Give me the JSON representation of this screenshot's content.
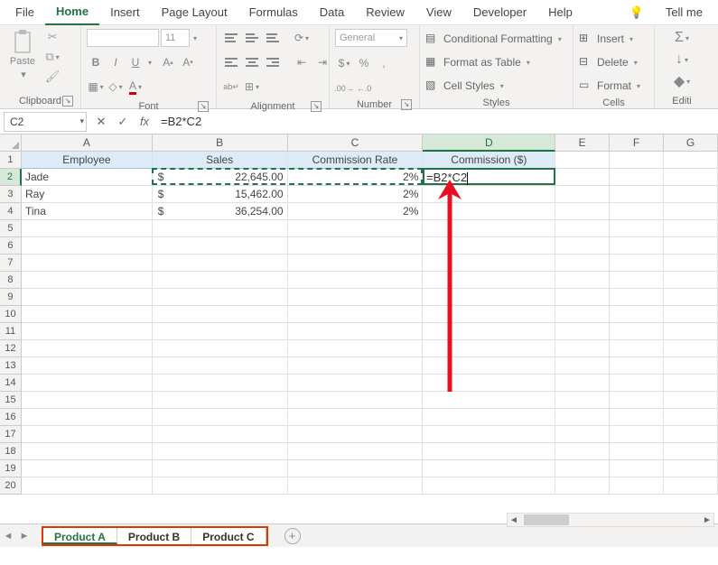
{
  "ribbon_tabs": {
    "file": "File",
    "home": "Home",
    "insert": "Insert",
    "page_layout": "Page Layout",
    "formulas": "Formulas",
    "data": "Data",
    "review": "Review",
    "view": "View",
    "developer": "Developer",
    "help": "Help",
    "tellme": "Tell me"
  },
  "clipboard": {
    "paste": "Paste",
    "label": "Clipboard"
  },
  "font": {
    "name": "",
    "size": "11",
    "bold": "B",
    "italic": "I",
    "underline": "U",
    "label": "Font"
  },
  "alignment": {
    "label": "Alignment"
  },
  "number": {
    "format": "General",
    "label": "Number"
  },
  "styles": {
    "cond": "Conditional Formatting",
    "table": "Format as Table",
    "cell": "Cell Styles",
    "label": "Styles"
  },
  "cells": {
    "insert": "Insert",
    "delete": "Delete",
    "format": "Format",
    "label": "Cells"
  },
  "editing": {
    "label": "Editi"
  },
  "namebox": "C2",
  "formula": "=B2*C2",
  "columns": [
    "A",
    "B",
    "C",
    "D",
    "E",
    "F",
    "G"
  ],
  "headers": {
    "a": "Employee",
    "b": "Sales",
    "c": "Commission Rate",
    "d": "Commission ($)"
  },
  "data_rows": [
    {
      "emp": "Jade",
      "sales": "22,645.00",
      "rate": "2%"
    },
    {
      "emp": "Ray",
      "sales": "15,462.00",
      "rate": "2%"
    },
    {
      "emp": "Tina",
      "sales": "36,254.00",
      "rate": "2%"
    }
  ],
  "currency": "$",
  "edit_value": "=B2*C2",
  "sheets": {
    "a": "Product A",
    "b": "Product B",
    "c": "Product C"
  }
}
